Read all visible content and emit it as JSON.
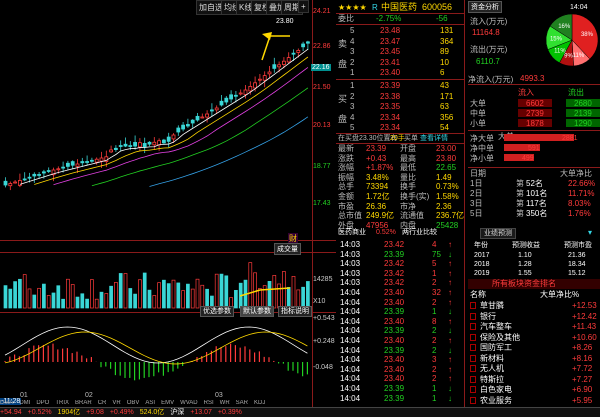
{
  "toolbar": {
    "add_self": "加自选",
    "back": "均线",
    "kline": "K线",
    "copy": "复权",
    "overlay": "叠加",
    "period": "周期",
    "extra": "+"
  },
  "chart": {
    "price_labels": [
      "24.21",
      "22.86",
      "21.50",
      "20.13",
      "18.77",
      "17.43"
    ],
    "price_colors": [
      "#ff3b3b",
      "#ff3b3b",
      "#ff3b3b",
      "#ff3b3b",
      "#22d022",
      "#22d022"
    ],
    "ma_badge": "22.16",
    "peak": "23.80",
    "low_label": "11.28",
    "fin_icon": "财",
    "vol_tab": "成交量",
    "vol_labels": [
      "14285",
      "X10"
    ],
    "vol_btns": [
      "优选参数",
      "默认参数",
      "指标说明"
    ],
    "macd_labels": [
      "+0.543",
      "+0.248",
      "-0.048"
    ],
    "months": [
      "01",
      "02",
      "03"
    ],
    "bottom_axis_labels": [
      "-11:28"
    ]
  },
  "stock": {
    "stars": "★★★★",
    "tag": "R",
    "name": "中国医药",
    "code": "600056",
    "weibi_label": "委比",
    "weibi_val": "-2.75%",
    "weicha_val": "-56"
  },
  "sell": [
    {
      "n": "5",
      "p": "23.48",
      "v": "131"
    },
    {
      "n": "4",
      "p": "23.47",
      "v": "364"
    },
    {
      "n": "3",
      "p": "23.45",
      "v": "89"
    },
    {
      "n": "2",
      "p": "23.41",
      "v": "10"
    },
    {
      "n": "1",
      "p": "23.40",
      "v": "6"
    }
  ],
  "buy": [
    {
      "n": "1",
      "p": "23.39",
      "v": "43"
    },
    {
      "n": "2",
      "p": "23.38",
      "v": "171"
    },
    {
      "n": "3",
      "p": "23.35",
      "v": "63"
    },
    {
      "n": "4",
      "p": "23.34",
      "v": "356"
    },
    {
      "n": "5",
      "p": "23.34",
      "v": "54"
    }
  ],
  "sell_side": {
    "label": "卖",
    "label2": "盘"
  },
  "buy_side": {
    "label": "买",
    "label2": "盘"
  },
  "notice": [
    "在买盘23.30位置有",
    "20手",
    "买单",
    "查看详情"
  ],
  "quote": [
    {
      "a": "最新",
      "b": "23.39",
      "c": "开盘",
      "d": "23.00"
    },
    {
      "a": "涨跌",
      "b": "+0.43",
      "c": "最高",
      "d": "23.80"
    },
    {
      "a": "涨幅",
      "b": "+1.87%",
      "c": "最低",
      "d": "22.65"
    },
    {
      "a": "振幅",
      "b": "3.48%",
      "c": "量比",
      "d": "1.49"
    },
    {
      "a": "总手",
      "b": "73394",
      "c": "换手",
      "d": "0.73%"
    },
    {
      "a": "金额",
      "b": "1.72亿",
      "c": "换手(实)",
      "d": "1.58%"
    },
    {
      "a": "市盈",
      "b": "26.36",
      "c": "市净",
      "d": "2.36"
    },
    {
      "a": "总市值",
      "b": "249.9亿",
      "c": "流通值",
      "d": "236.7亿"
    },
    {
      "a": "外盘",
      "b": "47956",
      "c": "内盘",
      "d": "25428"
    }
  ],
  "ticks_hdr": {
    "a": "医药商业",
    "b": "0.52%",
    "c": "两行业比较"
  },
  "ticks": [
    {
      "t": "14:03",
      "p": "23.42",
      "v": "4",
      "d": "up"
    },
    {
      "t": "14:03",
      "p": "23.39",
      "v": "75",
      "d": "dn"
    },
    {
      "t": "14:03",
      "p": "23.42",
      "v": "5",
      "d": "up"
    },
    {
      "t": "14:03",
      "p": "23.42",
      "v": "1",
      "d": "up"
    },
    {
      "t": "14:03",
      "p": "23.42",
      "v": "2",
      "d": "up"
    },
    {
      "t": "14:04",
      "p": "23.40",
      "v": "32",
      "d": "up"
    },
    {
      "t": "14:04",
      "p": "23.40",
      "v": "2",
      "d": "up"
    },
    {
      "t": "14:04",
      "p": "23.39",
      "v": "1",
      "d": "dn"
    },
    {
      "t": "14:04",
      "p": "23.40",
      "v": "8",
      "d": "up"
    },
    {
      "t": "14:04",
      "p": "23.39",
      "v": "2",
      "d": "dn"
    },
    {
      "t": "14:04",
      "p": "23.40",
      "v": "2",
      "d": "up"
    },
    {
      "t": "14:04",
      "p": "23.39",
      "v": "2",
      "d": "dn"
    },
    {
      "t": "14:04",
      "p": "23.40",
      "v": "3",
      "d": "up"
    },
    {
      "t": "14:04",
      "p": "23.40",
      "v": "2",
      "d": "up"
    },
    {
      "t": "14:04",
      "p": "23.40",
      "v": "2",
      "d": "up"
    },
    {
      "t": "14:04",
      "p": "23.39",
      "v": "1",
      "d": "dn"
    },
    {
      "t": "14:04",
      "p": "23.39",
      "v": "1",
      "d": "dn"
    }
  ],
  "capital": {
    "title": "资金分析",
    "time": "14:04",
    "in_label": "流入(万元)",
    "in_val": "11164.8",
    "out_label": "流出(万元)",
    "out_val": "6110.7",
    "net_label": "净流入(万元)",
    "net_val": "4993.3",
    "pie": [
      {
        "label": "38%",
        "v": 38,
        "color": "#e02020"
      },
      {
        "label": "11%",
        "v": 11,
        "color": "#ff7070"
      },
      {
        "label": "9%",
        "v": 9,
        "color": "#b01010"
      },
      {
        "label": "11%",
        "v": 11,
        "color": "#00c000"
      },
      {
        "label": "15%",
        "v": 15,
        "color": "#30e030"
      },
      {
        "label": "16%",
        "v": 16,
        "color": "#208020"
      }
    ]
  },
  "flow_hdr": {
    "a": "流入",
    "b": "流出"
  },
  "flows": [
    {
      "a": "大单",
      "b": "6602",
      "c": "2680"
    },
    {
      "a": "中单",
      "b": "2739",
      "c": "2139"
    },
    {
      "a": "小单",
      "b": "1878",
      "c": "1290"
    }
  ],
  "dd_hdr": "大单",
  "dd": [
    {
      "a": "净大单",
      "v": "2881"
    },
    {
      "a": "净中单",
      "v": "591"
    },
    {
      "a": "净小单",
      "v": "499"
    }
  ],
  "dd_rank_hdr": {
    "a": "日期",
    "b": "",
    "c": "大单净比"
  },
  "dd_rank": [
    {
      "a": "1日",
      "b": "第",
      "c": "52名",
      "d": "22.66%"
    },
    {
      "a": "2日",
      "b": "第",
      "c": "101名",
      "d": "11.71%"
    },
    {
      "a": "3日",
      "b": "第",
      "c": "117名",
      "d": "8.03%"
    },
    {
      "a": "5日",
      "b": "第",
      "c": "350名",
      "d": "1.76%"
    }
  ],
  "forecast": {
    "tab1": "业绩预测",
    "tab2": "",
    "hdr": [
      "年份",
      "预测收益",
      "预测市盈"
    ],
    "rows": [
      {
        "y": "2017",
        "e": "1.10",
        "pe": "21.36"
      },
      {
        "y": "2018",
        "e": "1.28",
        "pe": "18.34"
      },
      {
        "y": "2019",
        "e": "1.55",
        "pe": "15.12"
      }
    ]
  },
  "sector": {
    "title": "所有板块资金排名",
    "hdr": [
      "名称",
      "大单净比%"
    ],
    "rows": [
      {
        "n": "草甘膦",
        "v": "+12.53"
      },
      {
        "n": "银行",
        "v": "+12.42"
      },
      {
        "n": "汽车整车",
        "v": "+11.43"
      },
      {
        "n": "保险及其他",
        "v": "+10.60"
      },
      {
        "n": "国防军工",
        "v": "+8.26"
      },
      {
        "n": "新材料",
        "v": "+8.16"
      },
      {
        "n": "无人机",
        "v": "+7.72"
      },
      {
        "n": "特斯拉",
        "v": "+7.27"
      },
      {
        "n": "白色家电",
        "v": "+6.90"
      },
      {
        "n": "农业服务",
        "v": "+5.95"
      }
    ]
  },
  "statusbar": [
    "+54.94",
    "+0.52%",
    "1904亿",
    "+9.08",
    "+0.49%",
    "524.0亿",
    "沪深",
    "+13.07",
    "+0.39%"
  ],
  "tabs_bot": [
    "DMA",
    "DMI",
    "DPO",
    "TRIX",
    "BRAR",
    "CR",
    "VR",
    "OBV",
    "ASI",
    "EMV",
    "WVAD",
    "RSI",
    "WR",
    "SAR",
    "KDJ"
  ]
}
